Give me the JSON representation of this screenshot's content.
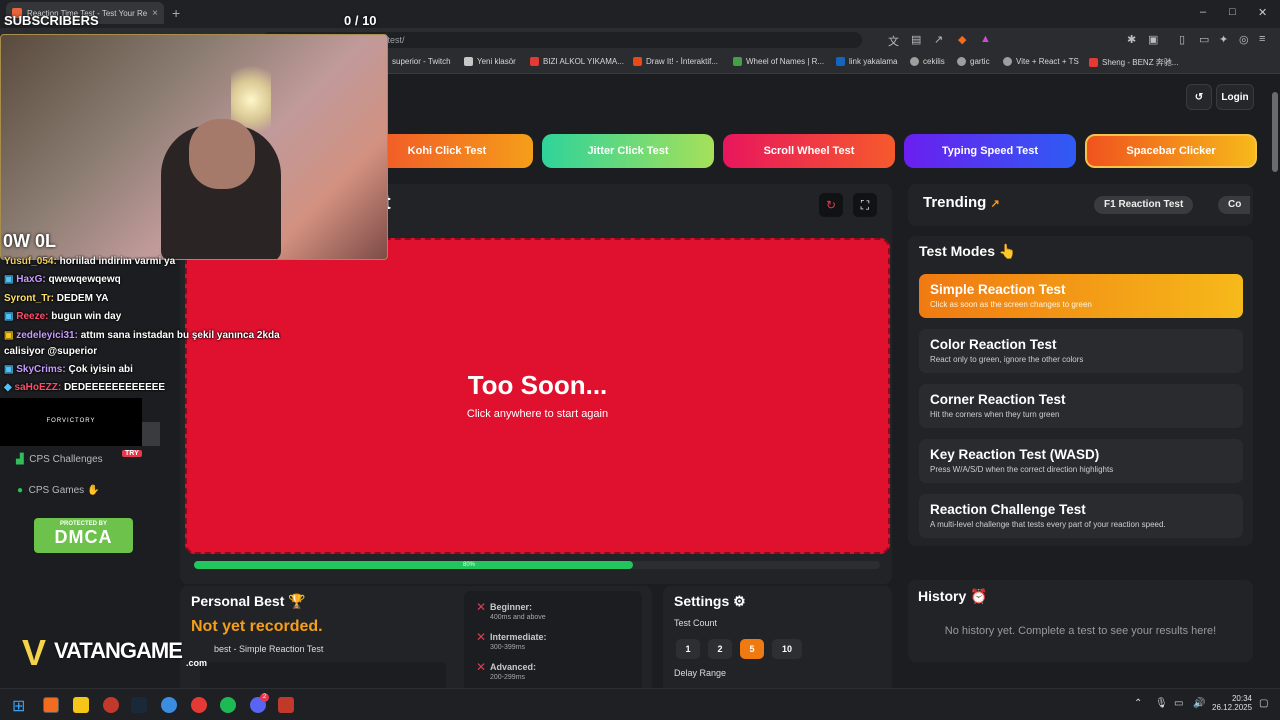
{
  "browser": {
    "tab_title": "Reaction Time Test - Test Your Re",
    "tab_close": "×",
    "new_tab": "+",
    "url": "cpstest.org/reaction-time-test/",
    "window_controls": [
      "–",
      "□",
      "✕"
    ],
    "bookmarks": [
      {
        "label": "superior - Twitch",
        "color": "#9146ff"
      },
      {
        "label": "Yeni klasör",
        "color": "#c7c7c7"
      },
      {
        "label": "BIZI ALKOL YIKAMA...",
        "color": "#e53935"
      },
      {
        "label": "Draw It! - İnteraktif...",
        "color": "#e64a19"
      },
      {
        "label": "Wheel of Names | R...",
        "color": "#43a047"
      },
      {
        "label": "link yakalama",
        "color": "#1565c0"
      },
      {
        "label": "cekilis",
        "color": "#9e9e9e"
      },
      {
        "label": "gartic",
        "color": "#9e9e9e"
      },
      {
        "label": "Vite + React + TS",
        "color": "#9e9e9e"
      },
      {
        "label": "Sheng - BENZ 奔驰...",
        "color": "#e53935"
      }
    ]
  },
  "header": {
    "login_label": "Login",
    "history_icon": "history-icon"
  },
  "nav_pills": [
    {
      "label": "Kohi Click Test",
      "from": "#f0532a",
      "to": "#f59e1a"
    },
    {
      "label": "Jitter Click Test",
      "from": "#2fd39a",
      "to": "#a6e05a"
    },
    {
      "label": "Scroll Wheel Test",
      "from": "#e8165d",
      "to": "#f65a2c"
    },
    {
      "label": "Typing Speed Test",
      "from": "#6a1ff0",
      "to": "#2f5bf3"
    },
    {
      "label": "Spacebar Clicker",
      "from": "#f0531e",
      "to": "#f6b91a"
    }
  ],
  "test_area": {
    "title_fragment": "t",
    "message": "Too Soon...",
    "sub_message": "Click anywhere to start again",
    "progress_pct": 80,
    "progress_label": "80%"
  },
  "trending": {
    "title": "Trending",
    "chips": [
      "F1 Reaction Test",
      "Co"
    ]
  },
  "test_modes": {
    "title": "Test Modes 👆",
    "items": [
      {
        "title": "Simple Reaction Test",
        "desc": "Click as soon as the screen changes to green",
        "active": true
      },
      {
        "title": "Color Reaction Test",
        "desc": "React only to green, ignore the other colors",
        "active": false
      },
      {
        "title": "Corner Reaction Test",
        "desc": "Hit the corners when they turn green",
        "active": false
      },
      {
        "title": "Key Reaction Test (WASD)",
        "desc": "Press W/A/S/D when the correct direction highlights",
        "active": false
      },
      {
        "title": "Reaction Challenge Test",
        "desc": "A multi-level challenge that tests every part of your reaction speed.",
        "active": false
      }
    ]
  },
  "personal_best": {
    "title": "Personal Best 🏆",
    "value": "Not yet recorded.",
    "sub": "best - Simple Reaction Test",
    "levels": [
      {
        "name": "Beginner:",
        "range": "400ms and above"
      },
      {
        "name": "Intermediate:",
        "range": "300-399ms"
      },
      {
        "name": "Advanced:",
        "range": "200-299ms"
      }
    ]
  },
  "settings": {
    "title": "Settings ⚙",
    "test_count_label": "Test Count",
    "counts": [
      "1",
      "2",
      "5",
      "10"
    ],
    "selected_count": "5",
    "delay_label": "Delay Range"
  },
  "history": {
    "title": "History ⏰",
    "empty": "No history yet. Complete a test to see your results here!"
  },
  "sidebar": {
    "items": [
      {
        "label": "CPS Challenges",
        "badge": "TRY"
      },
      {
        "label": "CPS Games"
      }
    ],
    "dmca": "DMCA",
    "dmca_sub": "PROTECTED BY"
  },
  "overlay": {
    "subscribers_label": "SUBSCRIBERS",
    "counter": "0 / 10",
    "webcam_label": "0W 0L",
    "vatangame": "VATANGAME",
    "vatangame_sub": ".com",
    "forvictory": "FORVICTORY",
    "chat": [
      {
        "user": "Yusuf_054:",
        "msg": "horiilad indirim varmi ya",
        "color": "#f0d060"
      },
      {
        "user": "HaxG:",
        "msg": "qwewqewqewq",
        "color": "#c79bff"
      },
      {
        "user": "Syront_Tr:",
        "msg": "DEDEM YA",
        "color": "#ffe066"
      },
      {
        "user": "Reeze:",
        "msg": "bugun win day",
        "color": "#ff4d6d"
      },
      {
        "user": "zedeleyici31:",
        "msg": "attım sana instadan bu şekil yanınca 2kda",
        "color": "#c79bff"
      },
      {
        "user": "",
        "msg": "calisiyor @superior",
        "color": "#ffffff"
      },
      {
        "user": "SkyCrims:",
        "msg": "Çok iyisin abi",
        "color": "#c79bff"
      },
      {
        "user": "saHoEZZ:",
        "msg": "DEDEEEEEEEEEEEE",
        "color": "#ff4d6d"
      }
    ]
  },
  "taskbar": {
    "clock_time": "20:34",
    "clock_date": "26.12.2025",
    "notification_count": "2"
  }
}
